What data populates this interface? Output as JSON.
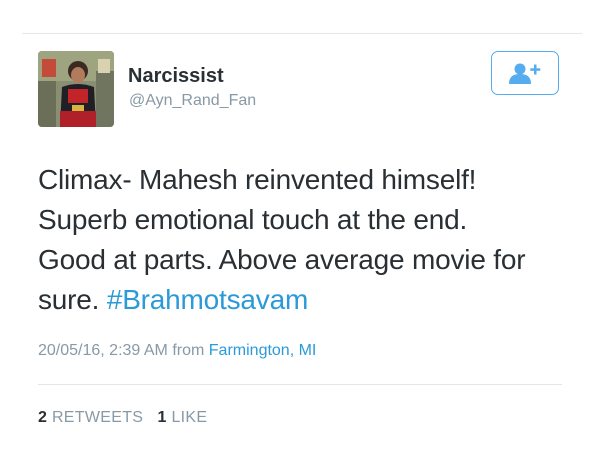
{
  "user": {
    "display_name": "Narcissist",
    "handle": "@Ayn_Rand_Fan",
    "avatar_icon": "profile-photo"
  },
  "follow_button": {
    "icon": "add-user-icon",
    "color": "#55acee"
  },
  "tweet": {
    "lines": [
      "Climax- Mahesh reinvented himself!",
      "Superb emotional touch at the end.",
      "Good at parts. Above average movie for"
    ],
    "last_line_text": "sure. ",
    "hashtag": "#Brahmotsavam"
  },
  "meta": {
    "timestamp": "20/05/16, 2:39 AM",
    "from_label": "from",
    "location": "Farmington, MI"
  },
  "stats": {
    "retweets_count": "2",
    "retweets_label": "RETWEETS",
    "likes_count": "1",
    "likes_label": "LIKE"
  },
  "colors": {
    "text": "#292f33",
    "secondary": "#8899a6",
    "link": "#2b9ad8",
    "divider": "#e1e8ed"
  }
}
